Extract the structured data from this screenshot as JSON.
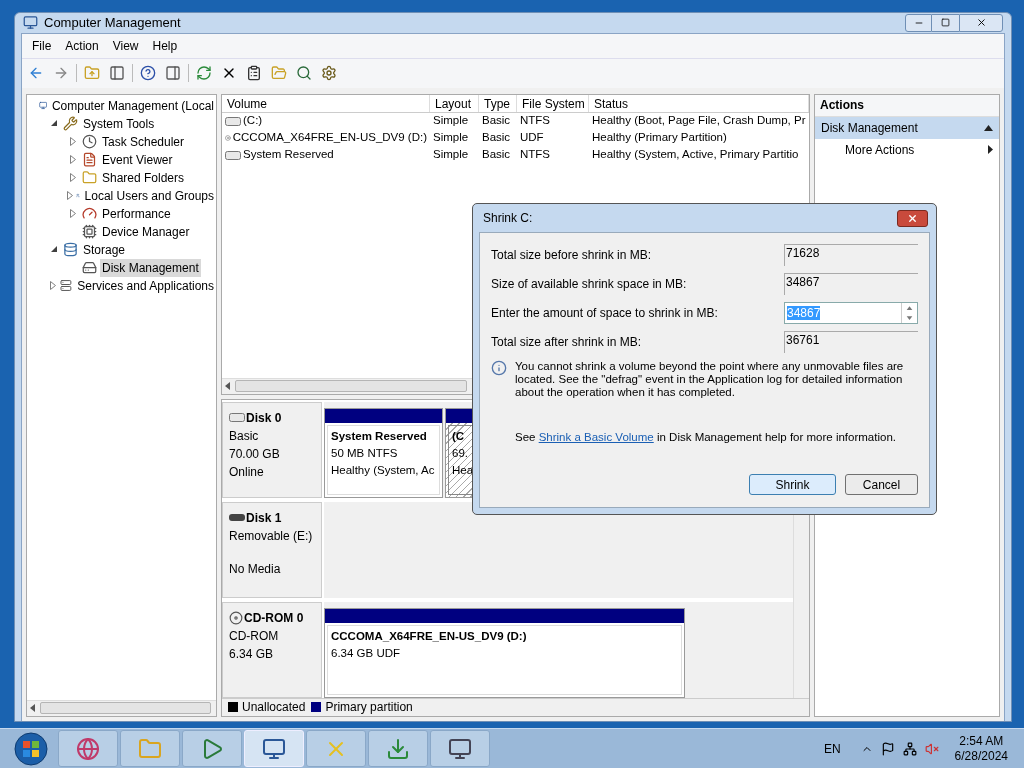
{
  "window": {
    "title": "Computer Management"
  },
  "menu": [
    {
      "label": "File"
    },
    {
      "label": "Action"
    },
    {
      "label": "View"
    },
    {
      "label": "Help"
    }
  ],
  "tree": [
    {
      "label": "Computer Management (Local",
      "kind": "root",
      "selected": false,
      "children": [
        {
          "label": "System Tools",
          "kind": "branch",
          "expanded": true,
          "selected": false,
          "children": [
            {
              "label": "Task Scheduler",
              "kind": "branch",
              "expanded": false,
              "selected": false
            },
            {
              "label": "Event Viewer",
              "kind": "branch",
              "expanded": false,
              "selected": false
            },
            {
              "label": "Shared Folders",
              "kind": "branch",
              "expanded": false,
              "selected": false
            },
            {
              "label": "Local Users and Groups",
              "kind": "branch",
              "expanded": false,
              "selected": false
            },
            {
              "label": "Performance",
              "kind": "branch",
              "expanded": false,
              "selected": false
            },
            {
              "label": "Device Manager",
              "kind": "leaf",
              "selected": false
            }
          ]
        },
        {
          "label": "Storage",
          "kind": "branch",
          "expanded": true,
          "selected": false,
          "children": [
            {
              "label": "Disk Management",
              "kind": "leaf",
              "selected": true
            }
          ]
        },
        {
          "label": "Services and Applications",
          "kind": "branch",
          "expanded": false,
          "selected": false
        }
      ]
    }
  ],
  "volumes": {
    "columns": [
      "Volume",
      "Layout",
      "Type",
      "File System",
      "Status"
    ],
    "rows": [
      {
        "kind": "disk",
        "cells": [
          "(C:)",
          "Simple",
          "Basic",
          "NTFS",
          "Healthy (Boot, Page File, Crash Dump, Pr"
        ]
      },
      {
        "kind": "cdrom",
        "cells": [
          "CCCOMA_X64FRE_EN-US_DV9 (D:)",
          "Simple",
          "Basic",
          "UDF",
          "Healthy (Primary Partition)"
        ]
      },
      {
        "kind": "disk",
        "cells": [
          "System Reserved",
          "Simple",
          "Basic",
          "NTFS",
          "Healthy (System, Active, Primary Partitio"
        ]
      }
    ]
  },
  "disks": [
    {
      "kind": "disk",
      "name": "Disk 0",
      "lines": [
        "Basic",
        "70.00 GB",
        "Online"
      ],
      "partitions": [
        {
          "name": "System Reserved",
          "lines": [
            "50 MB NTFS",
            "Healthy (System, Ac"
          ],
          "selected": false
        },
        {
          "name": "(C",
          "lines": [
            "69.",
            "Hea"
          ],
          "selected": true
        }
      ]
    },
    {
      "kind": "removable",
      "name": "Disk 1",
      "lines": [
        "Removable (E:)"
      ],
      "status": "No Media"
    },
    {
      "kind": "cdrom",
      "name": "CD-ROM 0",
      "lines": [
        "CD-ROM",
        "6.34 GB"
      ],
      "partitions": [
        {
          "name": "CCCOMA_X64FRE_EN-US_DV9  (D:)",
          "lines": [
            "6.34 GB UDF"
          ],
          "selected": false
        }
      ]
    }
  ],
  "legend": [
    {
      "label": "Unallocated",
      "color": "#000000"
    },
    {
      "label": "Primary partition",
      "color": "#000080"
    }
  ],
  "actions": {
    "title": "Actions",
    "section": {
      "label": "Disk Management",
      "expanded": true
    },
    "items": [
      {
        "label": "More Actions"
      }
    ]
  },
  "dialog": {
    "title": "Shrink C:",
    "fields": [
      {
        "label": "Total size before shrink in MB:",
        "value": "71628",
        "kind": "readonly",
        "selected": false
      },
      {
        "label": "Size of available shrink space in MB:",
        "value": "34867",
        "kind": "readonly",
        "selected": false
      },
      {
        "label": "Enter the amount of space to shrink in MB:",
        "value": "34867",
        "kind": "spin",
        "selected": true
      },
      {
        "label": "Total size after shrink in MB:",
        "value": "36761",
        "kind": "readonly",
        "selected": false
      }
    ],
    "info": "You cannot shrink a volume beyond the point where any unmovable files are located. See the \"defrag\" event in the Application log for detailed information about the operation when it has completed.",
    "help": {
      "before": "See",
      "link": "Shrink a Basic Volume",
      "after": "in Disk Management help for more information."
    },
    "buttons": [
      {
        "label": "Shrink",
        "default": true
      },
      {
        "label": "Cancel",
        "default": false
      }
    ]
  },
  "taskbar": {
    "apps": [
      {
        "selected": false
      },
      {
        "selected": false
      },
      {
        "selected": false
      },
      {
        "selected": true
      },
      {
        "selected": false
      },
      {
        "selected": false
      },
      {
        "selected": false
      }
    ],
    "language": "EN",
    "time": "2:54 AM",
    "date": "6/28/2024"
  }
}
